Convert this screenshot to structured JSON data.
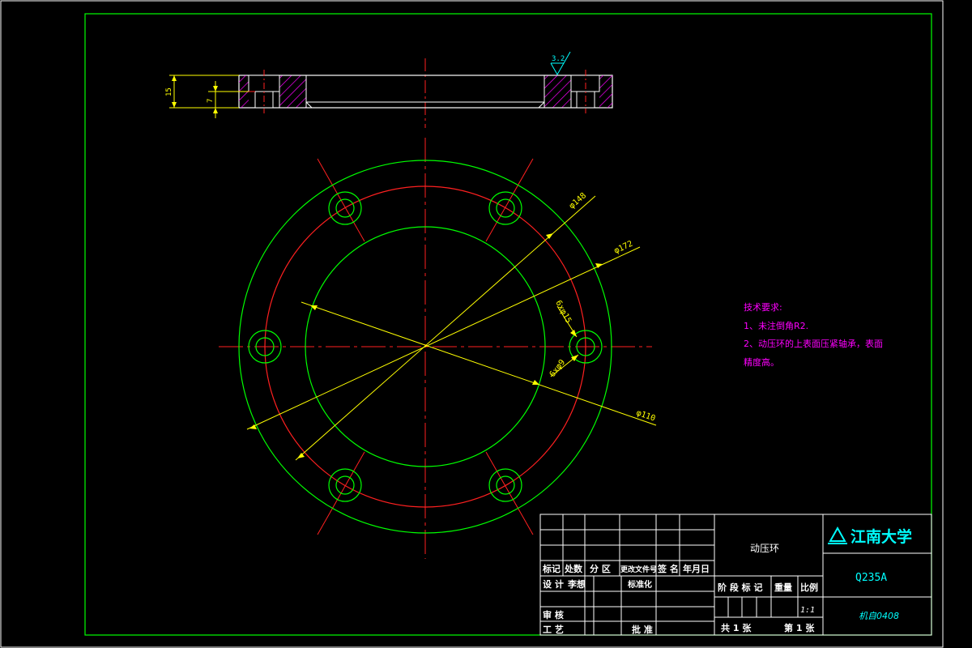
{
  "drawing": {
    "part_name": "动压环",
    "material": "Q235A",
    "drawing_number": "机自0408",
    "logo_text": "江南大学",
    "colors": {
      "background": "#000000",
      "border": "#00ff00",
      "center_line": "#ff2020",
      "dimension": "#ffff00",
      "outline": "#00ff00",
      "section_outline": "#ffffff",
      "hatch": "#ff00ff",
      "tech_text": "#ff00ff",
      "title_text": "#00ffff",
      "table_text": "#ffffff"
    }
  },
  "tech_requirements": {
    "heading": "技术要求:",
    "line1": "1、未注倒角R2.",
    "line2": "2、动压环的上表面压紧轴承，表面",
    "line3": "精度高。"
  },
  "dimensions": {
    "thickness_total": "15",
    "thickness_step": "7",
    "roughness": "3.2",
    "bolt_circle": "φ148",
    "outer_diameter": "φ172",
    "inner_diameter": "φ110",
    "counterbore": "6xφ15",
    "hole": "6xφ9"
  },
  "title_block": {
    "headers": {
      "mark": "标记",
      "count": "处数",
      "zone": "分 区",
      "change_doc": "更改文件号",
      "signature": "签 名",
      "date": "年月日"
    },
    "design": "设 计",
    "design_name": "李想",
    "standardize": "标准化",
    "review": "审 核",
    "process": "工 艺",
    "approve": "批 准",
    "stage_mark": "阶 段 标 记",
    "weight": "重量",
    "scale": "比例",
    "scale_value": "1:1",
    "total_sheets": "共 1 张",
    "sheet_no": "第 1 张"
  }
}
